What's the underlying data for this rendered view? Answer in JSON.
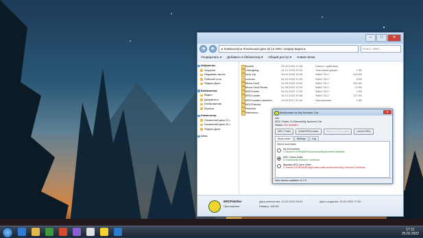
{
  "explorer": {
    "address": "▸ Компьютер ▸ Локальный диск (D:) ▸ MSC лоадер видео ▸",
    "search_placeholder": "Поиск: MSC...",
    "toolbar": [
      "Упорядочить ▾",
      "Добавить в библиотеку ▾",
      "Общий доступ ▾",
      "Новая папка"
    ],
    "nav_groups": [
      {
        "title": "Избранное",
        "items": [
          "Загрузки",
          "Недавние места",
          "Рабочий стол",
          "Яндекс.Диск"
        ]
      },
      {
        "title": "Библиотеки",
        "items": [
          "Видео",
          "Документы",
          "Изображения",
          "Музыка"
        ]
      },
      {
        "title": "Компьютер",
        "items": [
          "Локальный диск (C:)",
          "Локальный диск (D:)",
          "Яндекс.Диск"
        ]
      },
      {
        "title": "Сеть",
        "items": []
      }
    ],
    "files": [
      {
        "name": "Assets",
        "date": "25.02.2022 17:08",
        "type": "Папка с файлами",
        "size": ""
      },
      {
        "name": "Changelog",
        "date": "14.12.2019 20:15",
        "type": "Текстовый докум...",
        "size": "1 КБ"
      },
      {
        "name": "Ionic.Zip",
        "date": "26.02.2016 15:25",
        "type": "Файл \"DLL\"",
        "size": "433 КБ"
      },
      {
        "name": "License",
        "date": "04.04.2016 17:53",
        "type": "Файл \"DLL\"",
        "size": "6 КБ"
      },
      {
        "name": "Mono.Cecil",
        "date": "31.05.2019 13:09",
        "type": "Файл \"DLL\"",
        "size": "351 КБ"
      },
      {
        "name": "Mono.Cecil.Rocks",
        "date": "31.05.2019 13:09",
        "type": "Файл \"DLL\"",
        "size": "27 КБ"
      },
      {
        "name": "MSCFolder",
        "date": "25.02.2022 17:00",
        "type": "Файл \"DLL\"",
        "size": "1 КБ"
      },
      {
        "name": "MSCLoader",
        "date": "14.12.2019 19:58",
        "type": "Файл \"DLL\"",
        "size": "127 КБ"
      },
      {
        "name": "MSCLoader.Launcher",
        "date": "12.09.2017 20:40",
        "type": "Приложение",
        "size": "1 КБ"
      },
      {
        "name": "MSCPatcher",
        "date": "",
        "type": "",
        "size": ""
      },
      {
        "name": "Readme",
        "date": "",
        "type": "",
        "size": ""
      },
      {
        "name": "Reference...",
        "date": "",
        "type": "",
        "size": ""
      }
    ],
    "details": {
      "name": "MSCPatcher",
      "subtitle": "Приложение",
      "modified": "Дата изменения: 14.12.2019 20:04",
      "created": "Дата создания: 25.02.2022 17:00",
      "size": "Размер: 108 КБ"
    }
  },
  "loader": {
    "title": "ModLoader for My Summer Car",
    "info_label": "Info",
    "folder_line": "MSC Folder: D:\\Games\\My Summer Car",
    "status_label": "Status:",
    "status_value": "Not installed",
    "buttons": {
      "msc_folder": "MSC Folder",
      "install": "Install MSCLoader",
      "remove": "Remove MSCLoader",
      "launch": "Launch MSC"
    },
    "tabs": [
      "Mods folder",
      "Settings",
      "Log"
    ],
    "select_label": "Select mod folder",
    "options": [
      {
        "label": "My Documents",
        "path": "C:\\Users\\YOURNAME\\Documents\\MySummerCar\\Mods",
        "checked": false
      },
      {
        "label": "MSC Game folder",
        "path": "D:\\Games\\My Summer Car\\Mods",
        "checked": true
      },
      {
        "label": "Appdata MSC save folder",
        "path": "C:\\Users\\YOURNAME\\AppData\\LocalLow\\Amistech\\My Summer Car\\Mods",
        "checked": false
      }
    ],
    "status_bar": "New version available v1.2.5"
  },
  "taskbar": {
    "time": "17:11",
    "date": "25.02.2022"
  },
  "colors": {
    "status_red": "#c02020",
    "path_green": "#1f7a1f"
  }
}
